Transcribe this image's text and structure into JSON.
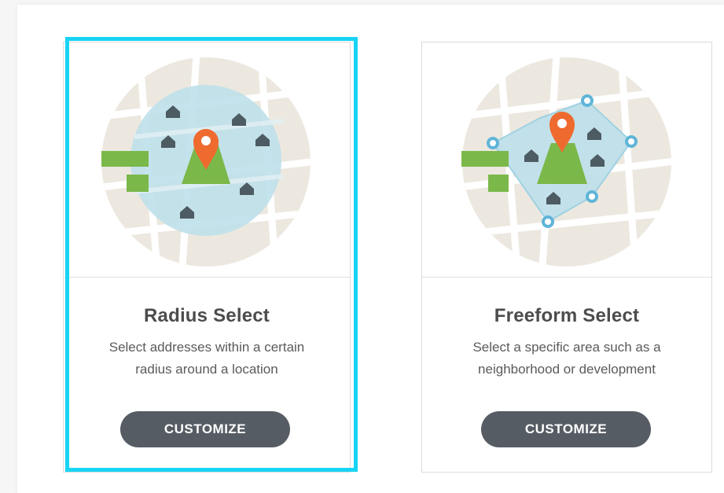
{
  "options": [
    {
      "id": "radius",
      "title": "Radius Select",
      "description": "Select addresses within a certain radius around a location",
      "button_label": "CUSTOMIZE",
      "selected": true,
      "illustration_icon": "radius-map-icon"
    },
    {
      "id": "freeform",
      "title": "Freeform Select",
      "description": "Select a specific area such as a neighborhood or development",
      "button_label": "CUSTOMIZE",
      "selected": false,
      "illustration_icon": "freeform-map-icon"
    }
  ],
  "colors": {
    "selection_outline": "#17d4f5",
    "button_bg": "#565c64",
    "pin": "#ef6a2f",
    "area_fill": "#bfe0ea",
    "park": "#7bb84a",
    "map_bg": "#ece8e0",
    "vertex": "#5fb5d8"
  }
}
